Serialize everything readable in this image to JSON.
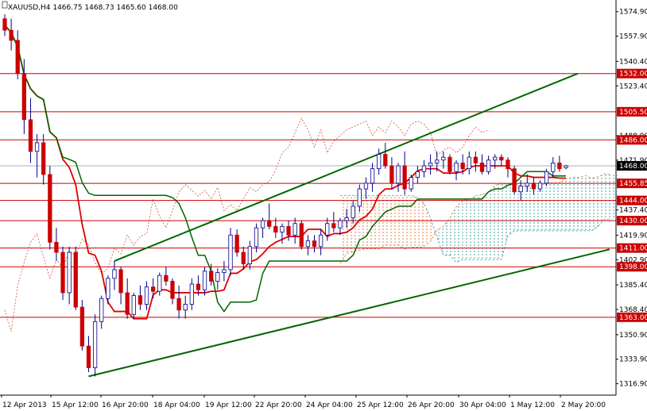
{
  "header": {
    "symbol_line": "XAUUSD,H4  1466.75 1468.73 1465.60 1468.00"
  },
  "chart_data": {
    "type": "candlestick",
    "symbol": "XAUUSD",
    "timeframe": "H4",
    "ohlc_header": {
      "open": 1466.75,
      "high": 1468.73,
      "low": 1465.6,
      "close": 1468.0
    },
    "ylim": [
      1309,
      1583
    ],
    "y_ticks": [
      "1574.90",
      "1557.90",
      "1540.40",
      "1523.40",
      "1488.90",
      "1471.90",
      "1437.40",
      "1419.90",
      "1402.90",
      "1385.40",
      "1368.40",
      "1350.90",
      "1333.90",
      "1316.90"
    ],
    "x_ticks": [
      "12 Apr 2013",
      "15 Apr 12:00",
      "16 Apr 20:00",
      "18 Apr 04:00",
      "19 Apr 12:00",
      "22 Apr 20:00",
      "24 Apr 04:00",
      "25 Apr 12:00",
      "26 Apr 20:00",
      "30 Apr 04:00",
      "1 May 12:00",
      "2 May 20:00"
    ],
    "horizontal_levels": [
      {
        "value": 1532.0,
        "label": "1532.00"
      },
      {
        "value": 1505.5,
        "label": "1505.50"
      },
      {
        "value": 1486.0,
        "label": "1486.00"
      },
      {
        "value": 1455.85,
        "label": "1455.85"
      },
      {
        "value": 1444.0,
        "label": "1444.00"
      },
      {
        "value": 1430.0,
        "label": "1430.00"
      },
      {
        "value": 1411.0,
        "label": "1411.00"
      },
      {
        "value": 1398.0,
        "label": "1398.00"
      },
      {
        "value": 1363.0,
        "label": "1363.00"
      }
    ],
    "current_price": {
      "value": 1468.0,
      "label": "1468.00"
    },
    "candles": [
      [
        1570,
        1573,
        1558,
        1562
      ],
      [
        1562,
        1570,
        1548,
        1555
      ],
      [
        1555,
        1562,
        1528,
        1532
      ],
      [
        1532,
        1542,
        1490,
        1500
      ],
      [
        1500,
        1515,
        1470,
        1478
      ],
      [
        1478,
        1490,
        1460,
        1484
      ],
      [
        1484,
        1490,
        1455,
        1462
      ],
      [
        1462,
        1468,
        1410,
        1415
      ],
      [
        1415,
        1425,
        1402,
        1408
      ],
      [
        1408,
        1412,
        1375,
        1380
      ],
      [
        1380,
        1412,
        1372,
        1408
      ],
      [
        1408,
        1412,
        1368,
        1370
      ],
      [
        1370,
        1375,
        1340,
        1343
      ],
      [
        1343,
        1350,
        1325,
        1328
      ],
      [
        1328,
        1365,
        1322,
        1360
      ],
      [
        1360,
        1378,
        1355,
        1376
      ],
      [
        1376,
        1392,
        1372,
        1390
      ],
      [
        1390,
        1402,
        1382,
        1396
      ],
      [
        1396,
        1398,
        1372,
        1380
      ],
      [
        1380,
        1390,
        1362,
        1365
      ],
      [
        1365,
        1380,
        1362,
        1378
      ],
      [
        1378,
        1385,
        1368,
        1372
      ],
      [
        1372,
        1388,
        1368,
        1384
      ],
      [
        1384,
        1390,
        1376,
        1381
      ],
      [
        1381,
        1394,
        1378,
        1392
      ],
      [
        1392,
        1398,
        1385,
        1388
      ],
      [
        1388,
        1390,
        1372,
        1376
      ],
      [
        1376,
        1385,
        1362,
        1368
      ],
      [
        1368,
        1378,
        1362,
        1372
      ],
      [
        1372,
        1390,
        1368,
        1386
      ],
      [
        1386,
        1392,
        1378,
        1382
      ],
      [
        1382,
        1398,
        1378,
        1395
      ],
      [
        1395,
        1400,
        1385,
        1388
      ],
      [
        1388,
        1397,
        1382,
        1394
      ],
      [
        1394,
        1402,
        1388,
        1396
      ],
      [
        1396,
        1425,
        1392,
        1420
      ],
      [
        1420,
        1424,
        1405,
        1408
      ],
      [
        1408,
        1412,
        1396,
        1400
      ],
      [
        1400,
        1416,
        1396,
        1412
      ],
      [
        1412,
        1428,
        1408,
        1425
      ],
      [
        1425,
        1432,
        1418,
        1430
      ],
      [
        1430,
        1442,
        1424,
        1426
      ],
      [
        1426,
        1432,
        1418,
        1422
      ],
      [
        1422,
        1428,
        1414,
        1426
      ],
      [
        1426,
        1430,
        1416,
        1420
      ],
      [
        1420,
        1432,
        1414,
        1428
      ],
      [
        1428,
        1430,
        1410,
        1412
      ],
      [
        1412,
        1420,
        1406,
        1416
      ],
      [
        1416,
        1420,
        1408,
        1412
      ],
      [
        1412,
        1424,
        1406,
        1420
      ],
      [
        1420,
        1432,
        1416,
        1428
      ],
      [
        1428,
        1436,
        1422,
        1425
      ],
      [
        1425,
        1432,
        1420,
        1430
      ],
      [
        1430,
        1438,
        1425,
        1432
      ],
      [
        1432,
        1444,
        1428,
        1440
      ],
      [
        1440,
        1455,
        1436,
        1452
      ],
      [
        1452,
        1460,
        1445,
        1456
      ],
      [
        1456,
        1470,
        1450,
        1466
      ],
      [
        1466,
        1480,
        1462,
        1476
      ],
      [
        1476,
        1484,
        1466,
        1468
      ],
      [
        1468,
        1474,
        1452,
        1456
      ],
      [
        1456,
        1470,
        1450,
        1468
      ],
      [
        1468,
        1478,
        1448,
        1452
      ],
      [
        1452,
        1462,
        1450,
        1460
      ],
      [
        1460,
        1468,
        1456,
        1464
      ],
      [
        1464,
        1472,
        1460,
        1468
      ],
      [
        1468,
        1476,
        1462,
        1470
      ],
      [
        1470,
        1478,
        1464,
        1472
      ],
      [
        1472,
        1478,
        1466,
        1474
      ],
      [
        1474,
        1476,
        1462,
        1464
      ],
      [
        1464,
        1472,
        1458,
        1470
      ],
      [
        1470,
        1476,
        1462,
        1466
      ],
      [
        1466,
        1478,
        1462,
        1474
      ],
      [
        1474,
        1478,
        1464,
        1470
      ],
      [
        1470,
        1476,
        1462,
        1464
      ],
      [
        1464,
        1475,
        1462,
        1472
      ],
      [
        1472,
        1476,
        1466,
        1474
      ],
      [
        1474,
        1476,
        1468,
        1472
      ],
      [
        1472,
        1474,
        1460,
        1466
      ],
      [
        1466,
        1468,
        1448,
        1450
      ],
      [
        1450,
        1458,
        1444,
        1454
      ],
      [
        1454,
        1462,
        1450,
        1456
      ],
      [
        1456,
        1460,
        1448,
        1452
      ],
      [
        1452,
        1458,
        1450,
        1456
      ],
      [
        1456,
        1466,
        1454,
        1464
      ],
      [
        1464,
        1474,
        1460,
        1470
      ],
      [
        1470,
        1475,
        1464,
        1466
      ],
      [
        1466.75,
        1468.73,
        1465.6,
        1468.0
      ]
    ]
  },
  "colors": {
    "background": "#ffffff",
    "level_line": "#cc0000",
    "level_label_bg": "#cc0000",
    "level_label_text": "#ffffff",
    "current_price_line": "#8899aa",
    "current_price_label_bg": "#000000",
    "current_price_label_text": "#ffffff",
    "candle_bull": "#ffffff",
    "candle_bear": "#cc0000",
    "candle_outline": "#00008b",
    "tenkan": "#dd0000",
    "kijun": "#006600",
    "trendline": "#006600",
    "cloud_bull": "#e08040",
    "cloud_bear": "#40a0a0",
    "chikou_span": "#cc5533"
  }
}
